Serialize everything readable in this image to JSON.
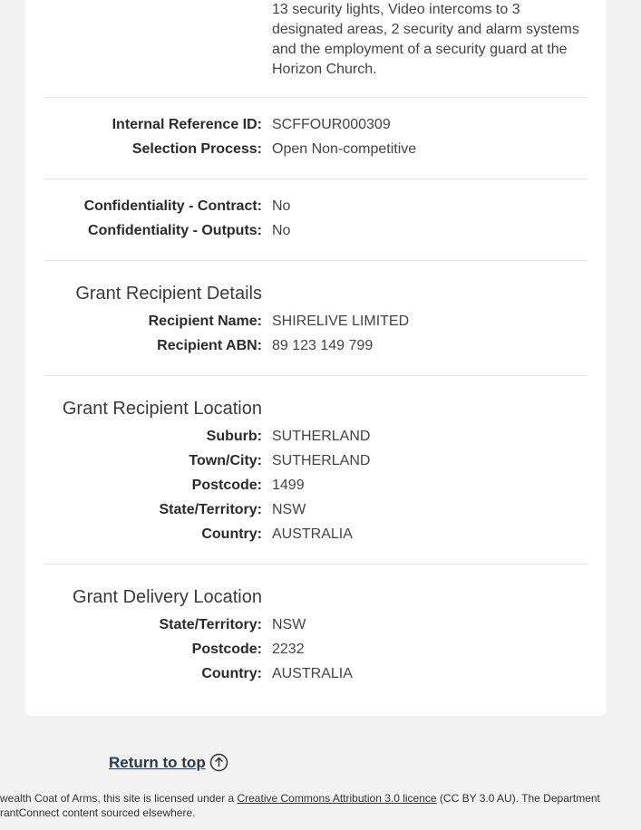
{
  "description": {
    "lines": [
      "13 security lights, Video intercoms to 3",
      "designated areas, 2 security and alarm systems",
      "and the employment of a security guard at the",
      "Horizon Church."
    ]
  },
  "reference": {
    "internal_ref_label": "Internal Reference ID:",
    "internal_ref_value": "SCFFOUR000309",
    "selection_label": "Selection Process:",
    "selection_value": "Open Non-competitive"
  },
  "confidentiality": {
    "contract_label": "Confidentiality - Contract:",
    "contract_value": "No",
    "outputs_label": "Confidentiality - Outputs:",
    "outputs_value": "No"
  },
  "recipient": {
    "heading": "Grant Recipient Details",
    "name_label": "Recipient Name:",
    "name_value": "SHIRELIVE LIMITED",
    "abn_label": "Recipient ABN:",
    "abn_value": "89 123 149 799"
  },
  "recipient_location": {
    "heading": "Grant Recipient Location",
    "suburb_label": "Suburb:",
    "suburb_value": "SUTHERLAND",
    "town_label": "Town/City:",
    "town_value": "SUTHERLAND",
    "postcode_label": "Postcode:",
    "postcode_value": "1499",
    "state_label": "State/Territory:",
    "state_value": "NSW",
    "country_label": "Country:",
    "country_value": "AUSTRALIA"
  },
  "delivery_location": {
    "heading": "Grant Delivery Location",
    "state_label": "State/Territory:",
    "state_value": "NSW",
    "postcode_label": "Postcode:",
    "postcode_value": "2232",
    "country_label": "Country:",
    "country_value": "AUSTRALIA"
  },
  "return_to_top": {
    "label": "Return to top",
    "icon": "arrow-up-circle-icon"
  },
  "footer": {
    "line1_prefix": "wealth Coat of Arms, this site is licensed under a ",
    "line1_link": "Creative Commons Attribution 3.0 licence",
    "line1_suffix": " (CC BY 3.0 AU). The Department",
    "line2": "rantConnect content sourced elsewhere."
  },
  "colors": {
    "page_background": "#f2f2f2",
    "card_background": "#ffffff",
    "divider": "#e6e6e6"
  }
}
